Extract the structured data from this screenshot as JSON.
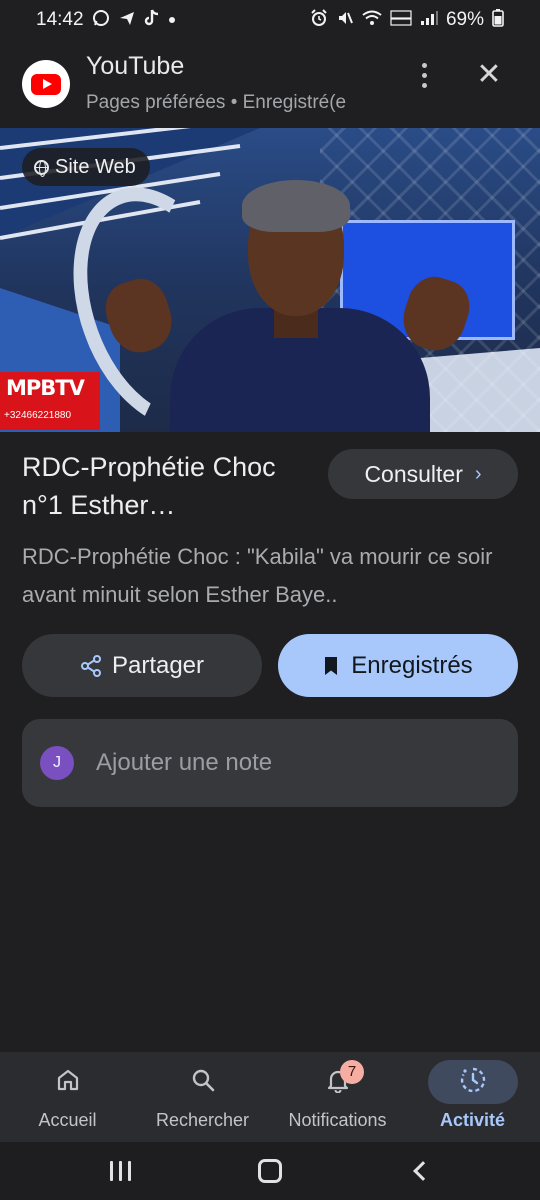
{
  "status_bar": {
    "time": "14:42",
    "left_icons": [
      "whatsapp-icon",
      "send-icon",
      "tiktok-icon",
      "dot-icon"
    ],
    "right_icons": [
      "alarm-icon",
      "mute-icon",
      "wifi-icon",
      "volte-icon",
      "signal-icon"
    ],
    "battery": "69%"
  },
  "header": {
    "title": "YouTube",
    "subtitle": "Pages préférées • Enregistré(e"
  },
  "hero": {
    "site_chip": "Site Web",
    "watermark_main": "MPBTV",
    "watermark_phone": "+32466221880"
  },
  "content": {
    "title": "RDC-Prophétie Choc n°1 Esther…",
    "consult_label": "Consulter",
    "description": "RDC-Prophétie Choc : \"Kabila\" va mourir ce soir avant minuit selon Esther Baye..",
    "share_label": "Partager",
    "saved_label": "Enregistrés"
  },
  "note": {
    "avatar_initial": "J",
    "placeholder": "Ajouter une note",
    "value": ""
  },
  "bottom_nav": {
    "items": [
      {
        "label": "Accueil",
        "icon": "home-icon"
      },
      {
        "label": "Rechercher",
        "icon": "search-icon"
      },
      {
        "label": "Notifications",
        "icon": "bell-icon",
        "badge": "7"
      },
      {
        "label": "Activité",
        "icon": "activity-icon",
        "active": true
      }
    ]
  },
  "colors": {
    "background": "#1f1f21",
    "accent": "#a8c8fb",
    "badge": "#f6aea3",
    "youtube_red": "#ff0000"
  }
}
